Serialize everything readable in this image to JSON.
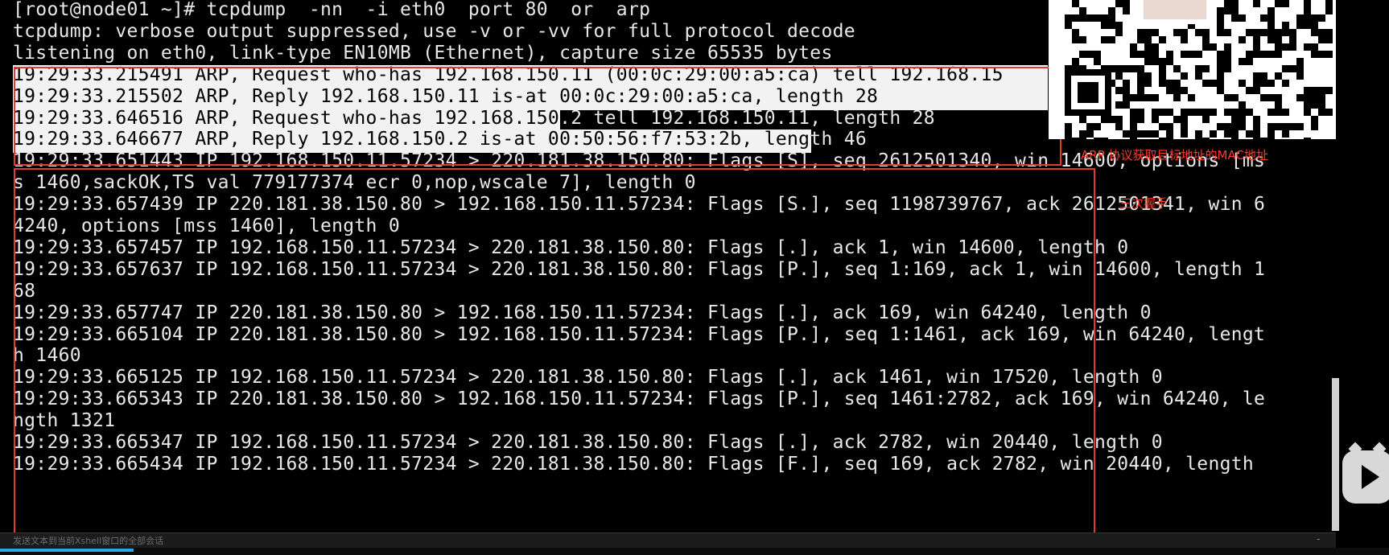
{
  "terminal": {
    "lines": [
      "[root@node01 ~]# tcpdump  -nn  -i eth0  port 80  or  arp",
      "tcpdump: verbose output suppressed, use -v or -vv for full protocol decode",
      "listening on eth0, link-type EN10MB (Ethernet), capture size 65535 bytes",
      "19:29:33.215491 ARP, Request who-has 192.168.150.11 (00:0c:29:00:a5:ca) tell 192.168.15",
      "19:29:33.215502 ARP, Reply 192.168.150.11 is-at 00:0c:29:00:a5:ca, length 28",
      "19:29:33.646516 ARP, Request who-has 192.168.150.2 tell 192.168.150.11, length 28",
      "19:29:33.646677 ARP, Reply 192.168.150.2 is-at 00:50:56:f7:53:2b, length 46",
      "19:29:33.651443 IP 192.168.150.11.57234 > 220.181.38.150.80: Flags [S], seq 2612501340, win 14600, options [ms",
      "s 1460,sackOK,TS val 779177374 ecr 0,nop,wscale 7], length 0",
      "19:29:33.657439 IP 220.181.38.150.80 > 192.168.150.11.57234: Flags [S.], seq 1198739767, ack 2612501341, win 6",
      "4240, options [mss 1460], length 0",
      "19:29:33.657457 IP 192.168.150.11.57234 > 220.181.38.150.80: Flags [.], ack 1, win 14600, length 0",
      "19:29:33.657637 IP 192.168.150.11.57234 > 220.181.38.150.80: Flags [P.], seq 1:169, ack 1, win 14600, length 1",
      "68",
      "19:29:33.657747 IP 220.181.38.150.80 > 192.168.150.11.57234: Flags [.], ack 169, win 64240, length 0",
      "19:29:33.665104 IP 220.181.38.150.80 > 192.168.150.11.57234: Flags [P.], seq 1:1461, ack 169, win 64240, lengt",
      "h 1460",
      "19:29:33.665125 IP 192.168.150.11.57234 > 220.181.38.150.80: Flags [.], ack 1461, win 17520, length 0",
      "19:29:33.665343 IP 220.181.38.150.80 > 192.168.150.11.57234: Flags [P.], seq 1461:2782, ack 169, win 64240, le",
      "ngth 1321",
      "19:29:33.665347 IP 192.168.150.11.57234 > 220.181.38.150.80: Flags [.], ack 2782, win 20440, length 0",
      "19:29:33.665434 IP 192.168.150.11.57234 > 220.181.38.150.80: Flags [F.], seq 169, ack 2782, win 20440, length"
    ]
  },
  "annotations": {
    "arp_note": "ARP 协议获取目标地址的MAC地址",
    "handshake_note": "三次握手"
  },
  "status_bar": {
    "text": "发送文本到当前Xshell窗口的全部会话",
    "dash": "-"
  },
  "colors": {
    "terminal_bg": "#000000",
    "terminal_fg": "#e8e8e8",
    "selection_bg": "#f2f2f2",
    "annotation_red": "#ff3b2f",
    "progress_blue": "#2aa7e5"
  },
  "icons": {
    "qr": "qr-code-icon",
    "play": "bilibili-play-icon"
  }
}
